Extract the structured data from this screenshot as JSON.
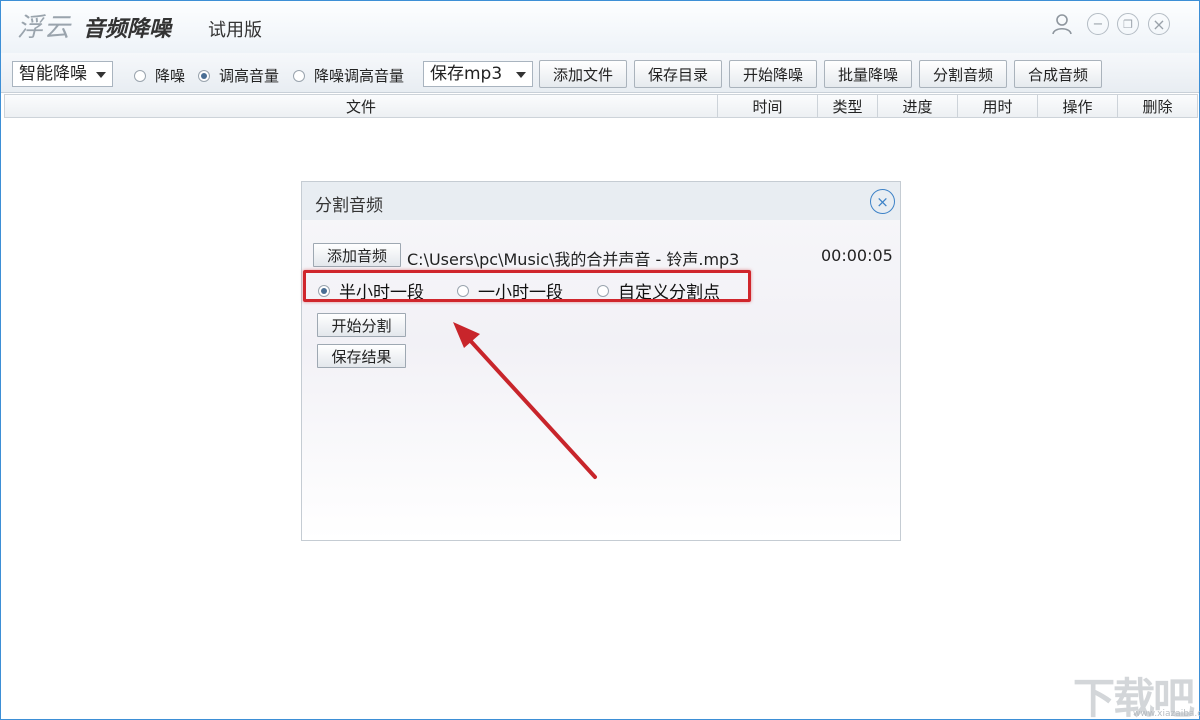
{
  "app": {
    "brand": "浮云",
    "name": "音频降噪",
    "edition": "试用版"
  },
  "window_controls": {
    "user_icon": "user-icon",
    "minimize_glyph": "−",
    "maximize_glyph": "❐",
    "close_glyph": "×"
  },
  "toolbar": {
    "mode_select": "智能降噪",
    "radios": [
      {
        "label": "降噪",
        "checked": false
      },
      {
        "label": "调高音量",
        "checked": true
      },
      {
        "label": "降噪调高音量",
        "checked": false
      }
    ],
    "format_select": "保存mp3",
    "buttons": [
      "添加文件",
      "保存目录",
      "开始降噪",
      "批量降噪",
      "分割音频",
      "合成音频"
    ]
  },
  "table": {
    "columns": [
      "文件",
      "时间",
      "类型",
      "进度",
      "用时",
      "操作",
      "删除"
    ]
  },
  "dialog": {
    "title": "分割音频",
    "close_glyph": "×",
    "add_audio_button": "添加音频",
    "file_path": "C:\\Users\\pc\\Music\\我的合并声音 - 铃声.mp3",
    "duration": "00:00:05",
    "options": [
      {
        "label": "半小时一段",
        "checked": true
      },
      {
        "label": "一小时一段",
        "checked": false
      },
      {
        "label": "自定义分割点",
        "checked": false
      }
    ],
    "start_button": "开始分割",
    "save_button": "保存结果"
  },
  "annotation": {
    "highlight_color": "#d0262c",
    "arrow_color": "#c8252b"
  },
  "watermark": {
    "main": "下载吧",
    "sub": "www.xiazaiba.com"
  }
}
